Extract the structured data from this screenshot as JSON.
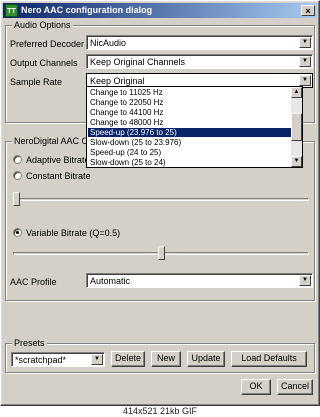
{
  "window": {
    "title": "Nero AAC configuration dialog",
    "close_glyph": "×",
    "app_icon_label": "TT"
  },
  "audio_options": {
    "title": "Audio Options",
    "preferred_decoder": {
      "label": "Preferred Decoder",
      "value": "NicAudio"
    },
    "output_channels": {
      "label": "Output Channels",
      "value": "Keep Original Channels"
    },
    "sample_rate": {
      "label": "Sample Rate",
      "value": "Keep Original",
      "options": [
        "Change to 11025 Hz",
        "Change to 22050 Hz",
        "Change to 44100 Hz",
        "Change to 48000 Hz",
        "Speed-up (23.976 to 25)",
        "Slow-down (25 to 23.976)",
        "Speed-up (24 to 25)",
        "Slow-down (25 to 24)"
      ],
      "selected_index": 4
    }
  },
  "neroaac": {
    "title": "NeroDigital AAC Op",
    "adaptive_label": "Adaptive Bitrate",
    "constant_label": "Constant Bitrate",
    "variable_label": "Variable Bitrate (Q=0.5)",
    "profile": {
      "label": "AAC Profile",
      "value": "Automatic"
    }
  },
  "presets": {
    "title": "Presets",
    "value": "*scratchpad*",
    "delete_label": "Delete",
    "new_label": "New",
    "update_label": "Update",
    "load_defaults_label": "Load Defaults"
  },
  "footer": {
    "ok_label": "OK",
    "cancel_label": "Cancel"
  },
  "caption": "414x521 21kb GIF",
  "icons": {
    "dropdown": "chevron-down-icon",
    "scroll_up": "scroll-up-icon",
    "scroll_down": "scroll-down-icon"
  }
}
